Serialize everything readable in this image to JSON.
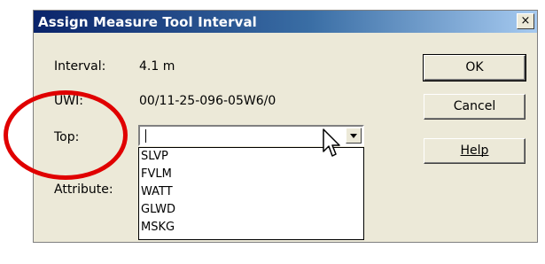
{
  "window": {
    "title": "Assign Measure Tool Interval",
    "close_glyph": "×"
  },
  "fields": {
    "interval_label": "Interval:",
    "interval_value": "4.1 m",
    "uwi_label": "UWI:",
    "uwi_value": "00/11-25-096-05W6/0",
    "top_label": "Top:",
    "top_value": "",
    "attribute_label": "Attribute:"
  },
  "buttons": {
    "ok": "OK",
    "cancel": "Cancel",
    "help": "Help"
  },
  "dropdown_items": [
    "SLVP",
    "FVLM",
    "WATT",
    "GLWD",
    "MSKG"
  ],
  "colors": {
    "title_bar_start": "#0a246a",
    "title_bar_end": "#a6caf0",
    "annotation_circle": "#e00000",
    "dialog_bg": "#ece9d8"
  }
}
